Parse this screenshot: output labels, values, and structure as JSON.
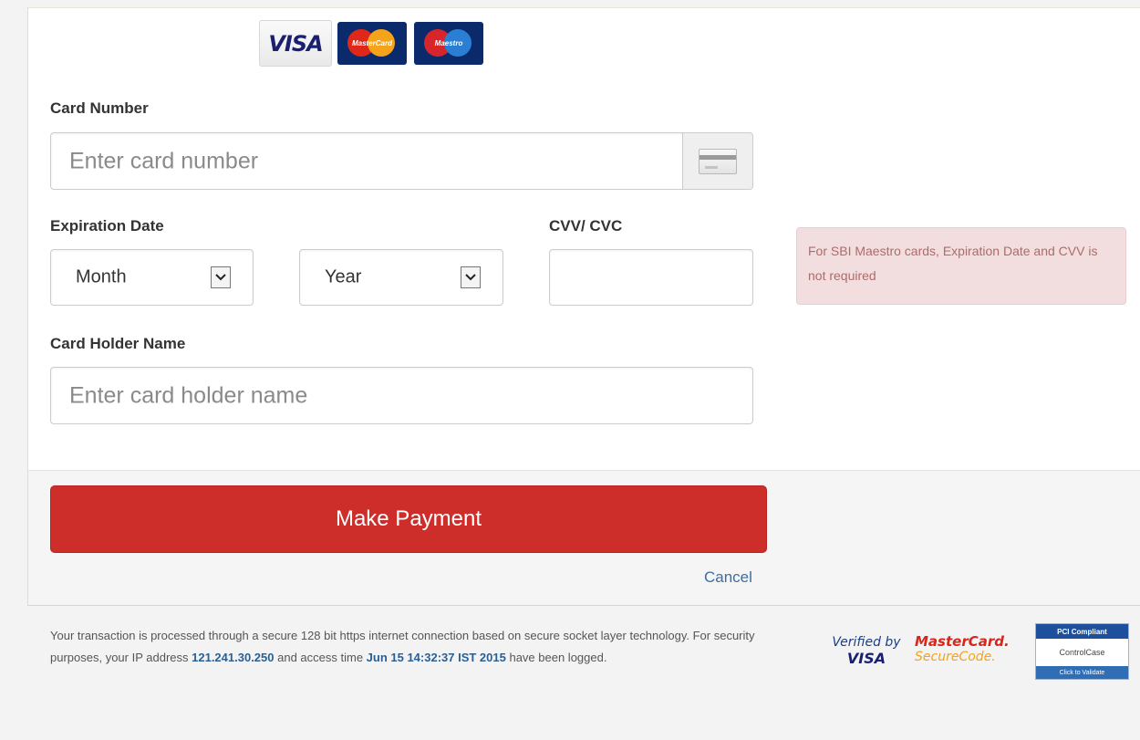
{
  "logos": {
    "visa": "VISA",
    "mastercard": "MasterCard",
    "maestro": "Maestro"
  },
  "card_number": {
    "label": "Card Number",
    "placeholder": "Enter card number",
    "icon": "credit-card-icon"
  },
  "expiration": {
    "label": "Expiration Date",
    "month_value": "Month",
    "year_value": "Year"
  },
  "cvv": {
    "label": "CVV/ CVC",
    "value": ""
  },
  "notice": {
    "text": "For SBI Maestro cards, Expiration Date and CVV is not required"
  },
  "card_holder": {
    "label": "Card Holder Name",
    "placeholder": "Enter card holder name"
  },
  "actions": {
    "pay_label": "Make Payment",
    "cancel_label": "Cancel"
  },
  "footer": {
    "text_1": "Your transaction is processed through a secure 128 bit https internet connection based on secure socket layer technology. For security purposes, your IP address ",
    "ip": "121.241.30.250",
    "text_2": " and access time ",
    "time": "Jun 15 14:32:37 IST 2015",
    "text_3": " have been logged."
  },
  "badges": {
    "vbv_line1": "Verified by",
    "vbv_line2": "VISA",
    "mc_line1": "MasterCard.",
    "mc_line2": "SecureCode.",
    "pci_top": "PCI Compliant",
    "pci_mid": "ControlCase",
    "pci_bot": "Click to Validate"
  },
  "colors": {
    "pay_button": "#cd2e2a",
    "cancel_link": "#3a6fa5",
    "notice_bg": "#f2dede",
    "notice_text": "#b06a6a",
    "footer_highlight": "#2b5f94"
  }
}
